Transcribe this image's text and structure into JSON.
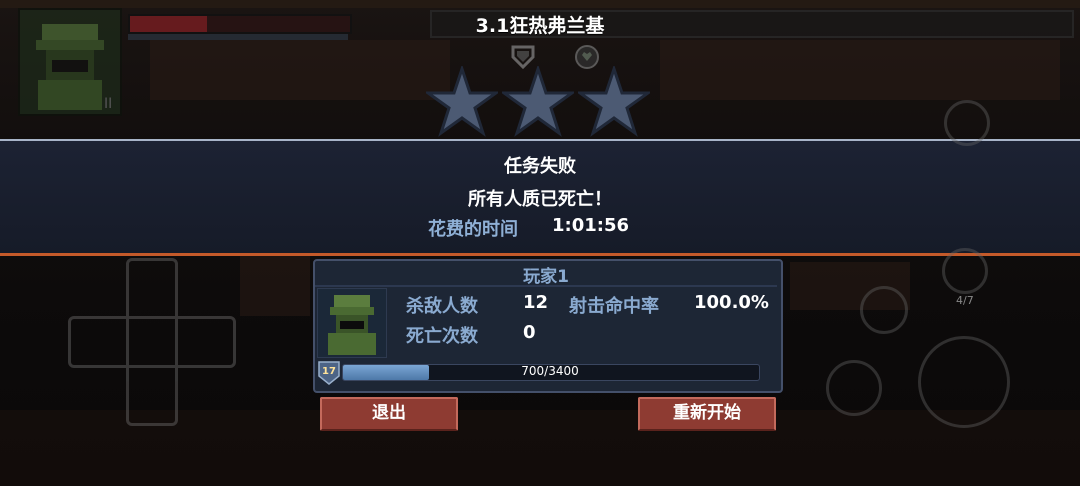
{
  "level": {
    "title": "3.1狂热弗兰基",
    "stars_earned": 0,
    "stars_total": 3
  },
  "hud": {
    "health_fraction": 0.35,
    "pause_glyph": "II",
    "ammo_counter": "4/7"
  },
  "result": {
    "title": "任务失败",
    "message": "所有人质已死亡！",
    "time_label": "花费的时间",
    "time_value": "1:01:56"
  },
  "player": {
    "name": "玩家1",
    "stats": {
      "kills_label": "杀敌人数",
      "kills_value": "12",
      "accuracy_label": "射击命中率",
      "accuracy_value": "100.0%",
      "deaths_label": "死亡次数",
      "deaths_value": "0"
    },
    "level_badge": "17",
    "xp_text": "700/3400",
    "xp_fraction": 0.206
  },
  "buttons": {
    "exit_label": "退出",
    "restart_label": "重新开始"
  },
  "colors": {
    "accent_blue": "#8aaad0",
    "button_red": "#8e3b32",
    "banner_bg": "#1c2233",
    "banner_border_bottom": "#c45a2a"
  },
  "icons": [
    "star-icon",
    "shield-icon",
    "soldier-avatar",
    "dpad",
    "grenade-icon",
    "fist-icon",
    "rifle-icon",
    "key-icon",
    "jump-icon"
  ]
}
